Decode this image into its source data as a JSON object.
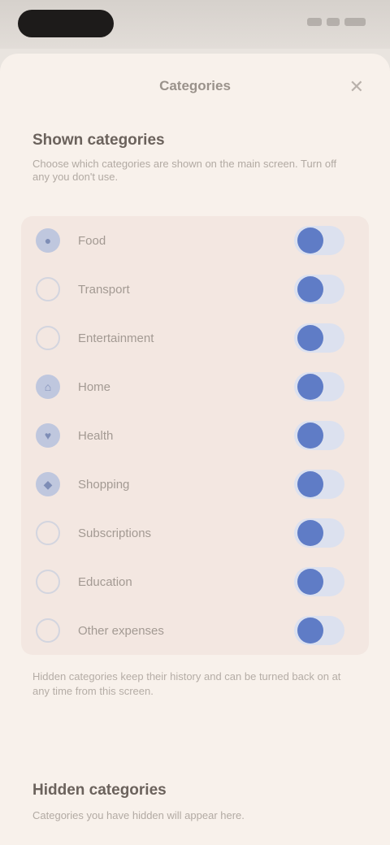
{
  "status_bar": {},
  "sheet": {
    "title": "Categories",
    "close_icon": "close-icon",
    "shown_section": {
      "title": "Shown categories",
      "description": "Choose which categories are shown on the main screen. Turn off any you don't use."
    },
    "categories": [
      {
        "label": "Food",
        "icon": "food-icon",
        "enabled": true
      },
      {
        "label": "Transport",
        "icon": "car-icon",
        "enabled": true
      },
      {
        "label": "Entertainment",
        "icon": "ticket-icon",
        "enabled": true
      },
      {
        "label": "Home",
        "icon": "home-icon",
        "enabled": true
      },
      {
        "label": "Health",
        "icon": "heart-icon",
        "enabled": true
      },
      {
        "label": "Shopping",
        "icon": "bag-icon",
        "enabled": true
      },
      {
        "label": "Subscriptions",
        "icon": "repeat-icon",
        "enabled": true
      },
      {
        "label": "Education",
        "icon": "book-icon",
        "enabled": true
      },
      {
        "label": "Other expenses",
        "icon": "dots-icon",
        "enabled": true
      }
    ],
    "footnote": "Hidden categories keep their history and can be turned back on at any time from this screen.",
    "hidden_section": {
      "title": "Hidden categories",
      "description": "Categories you have hidden will appear here."
    }
  },
  "colors": {
    "accent": "#5f7cc6",
    "toggle_track": "#dce1ef",
    "card_bg": "#f3e7e1",
    "sheet_bg": "#f8f1eb"
  }
}
